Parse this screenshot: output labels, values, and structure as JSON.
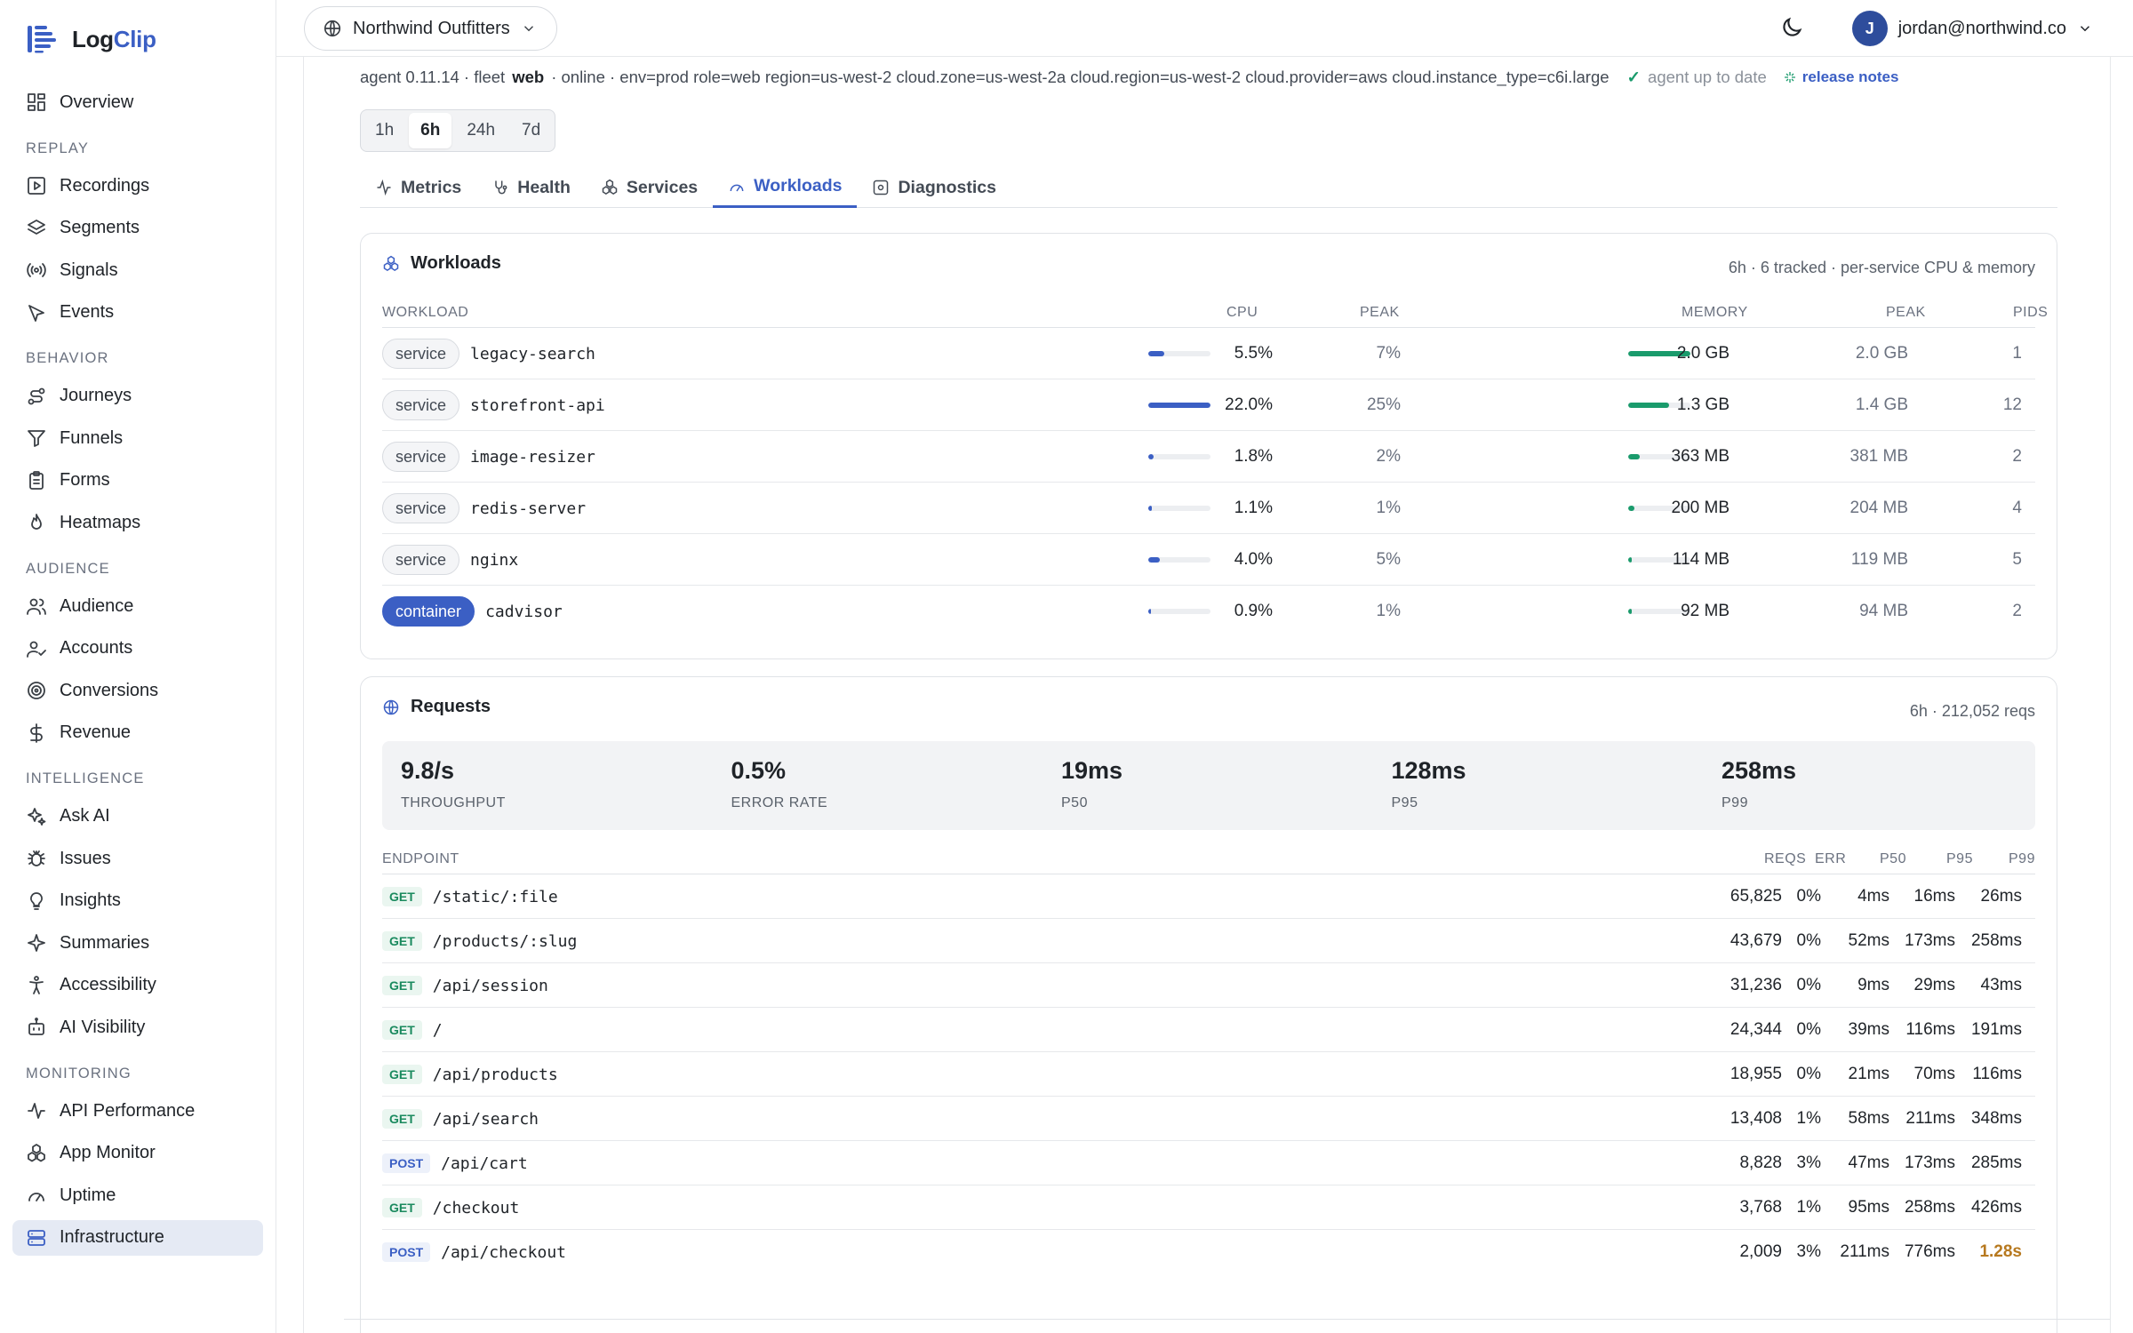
{
  "app": {
    "name_part1": "Log",
    "name_part2": "Clip"
  },
  "topbar": {
    "org_name": "Northwind Outfitters",
    "user_initial": "J",
    "user_email": "jordan@northwind.co"
  },
  "sidebar": {
    "overview": "Overview",
    "sections": [
      {
        "title": "REPLAY",
        "items": [
          {
            "label": "Recordings",
            "icon": "play-square-icon"
          },
          {
            "label": "Segments",
            "icon": "layers-icon"
          },
          {
            "label": "Signals",
            "icon": "broadcast-icon"
          },
          {
            "label": "Events",
            "icon": "pointer-icon"
          }
        ]
      },
      {
        "title": "BEHAVIOR",
        "items": [
          {
            "label": "Journeys",
            "icon": "route-icon"
          },
          {
            "label": "Funnels",
            "icon": "funnel-icon"
          },
          {
            "label": "Forms",
            "icon": "clipboard-icon"
          },
          {
            "label": "Heatmaps",
            "icon": "flame-icon"
          }
        ]
      },
      {
        "title": "AUDIENCE",
        "items": [
          {
            "label": "Audience",
            "icon": "users-icon"
          },
          {
            "label": "Accounts",
            "icon": "user-check-icon"
          },
          {
            "label": "Conversions",
            "icon": "target-icon"
          },
          {
            "label": "Revenue",
            "icon": "dollar-icon"
          }
        ]
      },
      {
        "title": "INTELLIGENCE",
        "items": [
          {
            "label": "Ask AI",
            "icon": "sparkles-icon"
          },
          {
            "label": "Issues",
            "icon": "bug-icon"
          },
          {
            "label": "Insights",
            "icon": "lightbulb-icon"
          },
          {
            "label": "Summaries",
            "icon": "sparkle-icon"
          },
          {
            "label": "Accessibility",
            "icon": "accessibility-icon"
          },
          {
            "label": "AI Visibility",
            "icon": "bot-icon"
          }
        ]
      },
      {
        "title": "MONITORING",
        "items": [
          {
            "label": "API Performance",
            "icon": "activity-icon"
          },
          {
            "label": "App Monitor",
            "icon": "boxes-icon"
          },
          {
            "label": "Uptime",
            "icon": "gauge-icon"
          },
          {
            "label": "Infrastructure",
            "icon": "server-icon",
            "active": true
          }
        ]
      }
    ]
  },
  "agent": {
    "version": "agent 0.11.14 · fleet",
    "fleet": "web",
    "status_tags": "· online · env=prod role=web region=us-west-2 cloud.zone=us-west-2a cloud.region=us-west-2 cloud.provider=aws cloud.instance_type=c6i.large",
    "uptodate": "agent up to date",
    "release_notes": "release notes"
  },
  "ranges": [
    {
      "label": "1h"
    },
    {
      "label": "6h",
      "active": true
    },
    {
      "label": "24h"
    },
    {
      "label": "7d"
    }
  ],
  "tabs": [
    {
      "label": "Metrics",
      "icon": "activity-icon"
    },
    {
      "label": "Health",
      "icon": "stethoscope-icon"
    },
    {
      "label": "Services",
      "icon": "boxes-icon"
    },
    {
      "label": "Workloads",
      "icon": "gauge-icon",
      "active": true
    },
    {
      "label": "Diagnostics",
      "icon": "scan-icon"
    }
  ],
  "workloads": {
    "title": "Workloads",
    "meta": "6h · 6 tracked · per-service CPU & memory",
    "headers": {
      "workload": "WORKLOAD",
      "cpu": "CPU",
      "peak": "PEAK",
      "memory": "MEMORY",
      "mem_peak": "PEAK",
      "pids": "PIDS"
    },
    "rows": [
      {
        "kind": "service",
        "name": "legacy-search",
        "cpu": "5.5%",
        "cpu_frac": 0.25,
        "cpu_peak": "7%",
        "mem": "2.0 GB",
        "mem_frac": 1.0,
        "mem_peak": "2.0 GB",
        "pids": "1"
      },
      {
        "kind": "service",
        "name": "storefront-api",
        "cpu": "22.0%",
        "cpu_frac": 1.0,
        "cpu_peak": "25%",
        "mem": "1.3 GB",
        "mem_frac": 0.65,
        "mem_peak": "1.4 GB",
        "pids": "12"
      },
      {
        "kind": "service",
        "name": "image-resizer",
        "cpu": "1.8%",
        "cpu_frac": 0.08,
        "cpu_peak": "2%",
        "mem": "363 MB",
        "mem_frac": 0.18,
        "mem_peak": "381 MB",
        "pids": "2"
      },
      {
        "kind": "service",
        "name": "redis-server",
        "cpu": "1.1%",
        "cpu_frac": 0.05,
        "cpu_peak": "1%",
        "mem": "200 MB",
        "mem_frac": 0.1,
        "mem_peak": "204 MB",
        "pids": "4"
      },
      {
        "kind": "service",
        "name": "nginx",
        "cpu": "4.0%",
        "cpu_frac": 0.18,
        "cpu_peak": "5%",
        "mem": "114 MB",
        "mem_frac": 0.06,
        "mem_peak": "119 MB",
        "pids": "5"
      },
      {
        "kind": "container",
        "name": "cadvisor",
        "cpu": "0.9%",
        "cpu_frac": 0.04,
        "cpu_peak": "1%",
        "mem": "92 MB",
        "mem_frac": 0.05,
        "mem_peak": "94 MB",
        "pids": "2"
      }
    ]
  },
  "requests": {
    "title": "Requests",
    "meta": "6h · 212,052 reqs",
    "stats": [
      {
        "value": "9.8/s",
        "label": "THROUGHPUT"
      },
      {
        "value": "0.5%",
        "label": "ERROR RATE"
      },
      {
        "value": "19ms",
        "label": "P50"
      },
      {
        "value": "128ms",
        "label": "P95"
      },
      {
        "value": "258ms",
        "label": "P99"
      }
    ],
    "headers": {
      "endpoint": "ENDPOINT",
      "reqs": "REQS",
      "err": "ERR",
      "p50": "P50",
      "p95": "P95",
      "p99": "P99"
    },
    "rows": [
      {
        "method": "GET",
        "path": "/static/:file",
        "reqs": "65,825",
        "err": "0%",
        "p50": "4ms",
        "p95": "16ms",
        "p99": "26ms"
      },
      {
        "method": "GET",
        "path": "/products/:slug",
        "reqs": "43,679",
        "err": "0%",
        "p50": "52ms",
        "p95": "173ms",
        "p99": "258ms"
      },
      {
        "method": "GET",
        "path": "/api/session",
        "reqs": "31,236",
        "err": "0%",
        "p50": "9ms",
        "p95": "29ms",
        "p99": "43ms"
      },
      {
        "method": "GET",
        "path": "/",
        "reqs": "24,344",
        "err": "0%",
        "p50": "39ms",
        "p95": "116ms",
        "p99": "191ms"
      },
      {
        "method": "GET",
        "path": "/api/products",
        "reqs": "18,955",
        "err": "0%",
        "p50": "21ms",
        "p95": "70ms",
        "p99": "116ms"
      },
      {
        "method": "GET",
        "path": "/api/search",
        "reqs": "13,408",
        "err": "1%",
        "p50": "58ms",
        "p95": "211ms",
        "p99": "348ms"
      },
      {
        "method": "POST",
        "path": "/api/cart",
        "reqs": "8,828",
        "err": "3%",
        "p50": "47ms",
        "p95": "173ms",
        "p99": "285ms"
      },
      {
        "method": "GET",
        "path": "/checkout",
        "reqs": "3,768",
        "err": "1%",
        "p50": "95ms",
        "p95": "258ms",
        "p99": "426ms"
      },
      {
        "method": "POST",
        "path": "/api/checkout",
        "reqs": "2,009",
        "err": "3%",
        "p50": "211ms",
        "p95": "776ms",
        "p99": "1.28s",
        "p99_warn": true
      }
    ]
  },
  "colors": {
    "accent": "#3b5fc4",
    "cpu_bar": "#3b5fc4",
    "mem_bar": "#1a9b6c",
    "warn": "#b7791f"
  }
}
